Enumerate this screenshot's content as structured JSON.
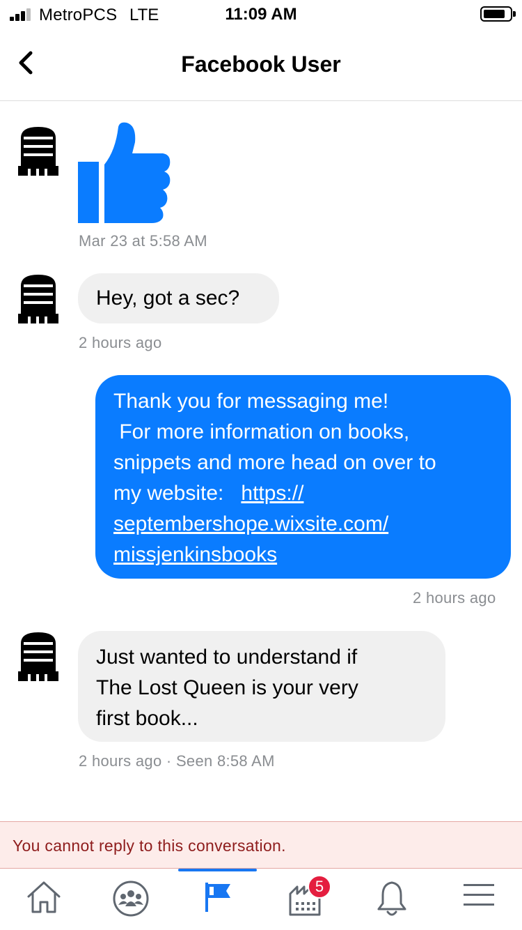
{
  "status_bar": {
    "carrier": "MetroPCS",
    "network": "LTE",
    "time": "11:09 AM",
    "signal_bars": 3,
    "battery_level": 0.75
  },
  "header": {
    "back_icon": "chevron-left-icon",
    "title": "Facebook User"
  },
  "messages": [
    {
      "sender": "other",
      "type": "sticker",
      "sticker_icon": "thumbs-up-icon",
      "timestamp": "Mar 23 at 5:58 AM"
    },
    {
      "sender": "other",
      "type": "text",
      "text": "Hey,  got a sec?",
      "timestamp": "2 hours ago"
    },
    {
      "sender": "self",
      "type": "text",
      "lines": [
        "Thank you for messaging me!",
        " For more information on books,",
        "snippets and more head on over to",
        "my website: "
      ],
      "link_lines": [
        "https://",
        "septembershope.wixsite.com/",
        "missjenkinsbooks"
      ],
      "timestamp": "2 hours ago"
    },
    {
      "sender": "other",
      "type": "text",
      "lines": [
        "Just wanted to understand if",
        "The Lost Queen is your very",
        "first book..."
      ],
      "timestamp": "2 hours ago · Seen 8:58 AM"
    }
  ],
  "notice": {
    "text": "You cannot reply to this conversation."
  },
  "tabbar": {
    "tabs": [
      {
        "name": "home-icon"
      },
      {
        "name": "groups-icon"
      },
      {
        "name": "pages-flag-icon",
        "active": true
      },
      {
        "name": "marketplace-icon",
        "badge": "5"
      },
      {
        "name": "notifications-bell-icon"
      },
      {
        "name": "menu-icon"
      }
    ],
    "accent": "#1877f2"
  },
  "colors": {
    "outgoing_bubble": "#0a7cff",
    "incoming_bubble": "#f0f0f0",
    "badge": "#e41e3f",
    "notice_bg": "#fdecea",
    "notice_text": "#8e1c1c"
  }
}
